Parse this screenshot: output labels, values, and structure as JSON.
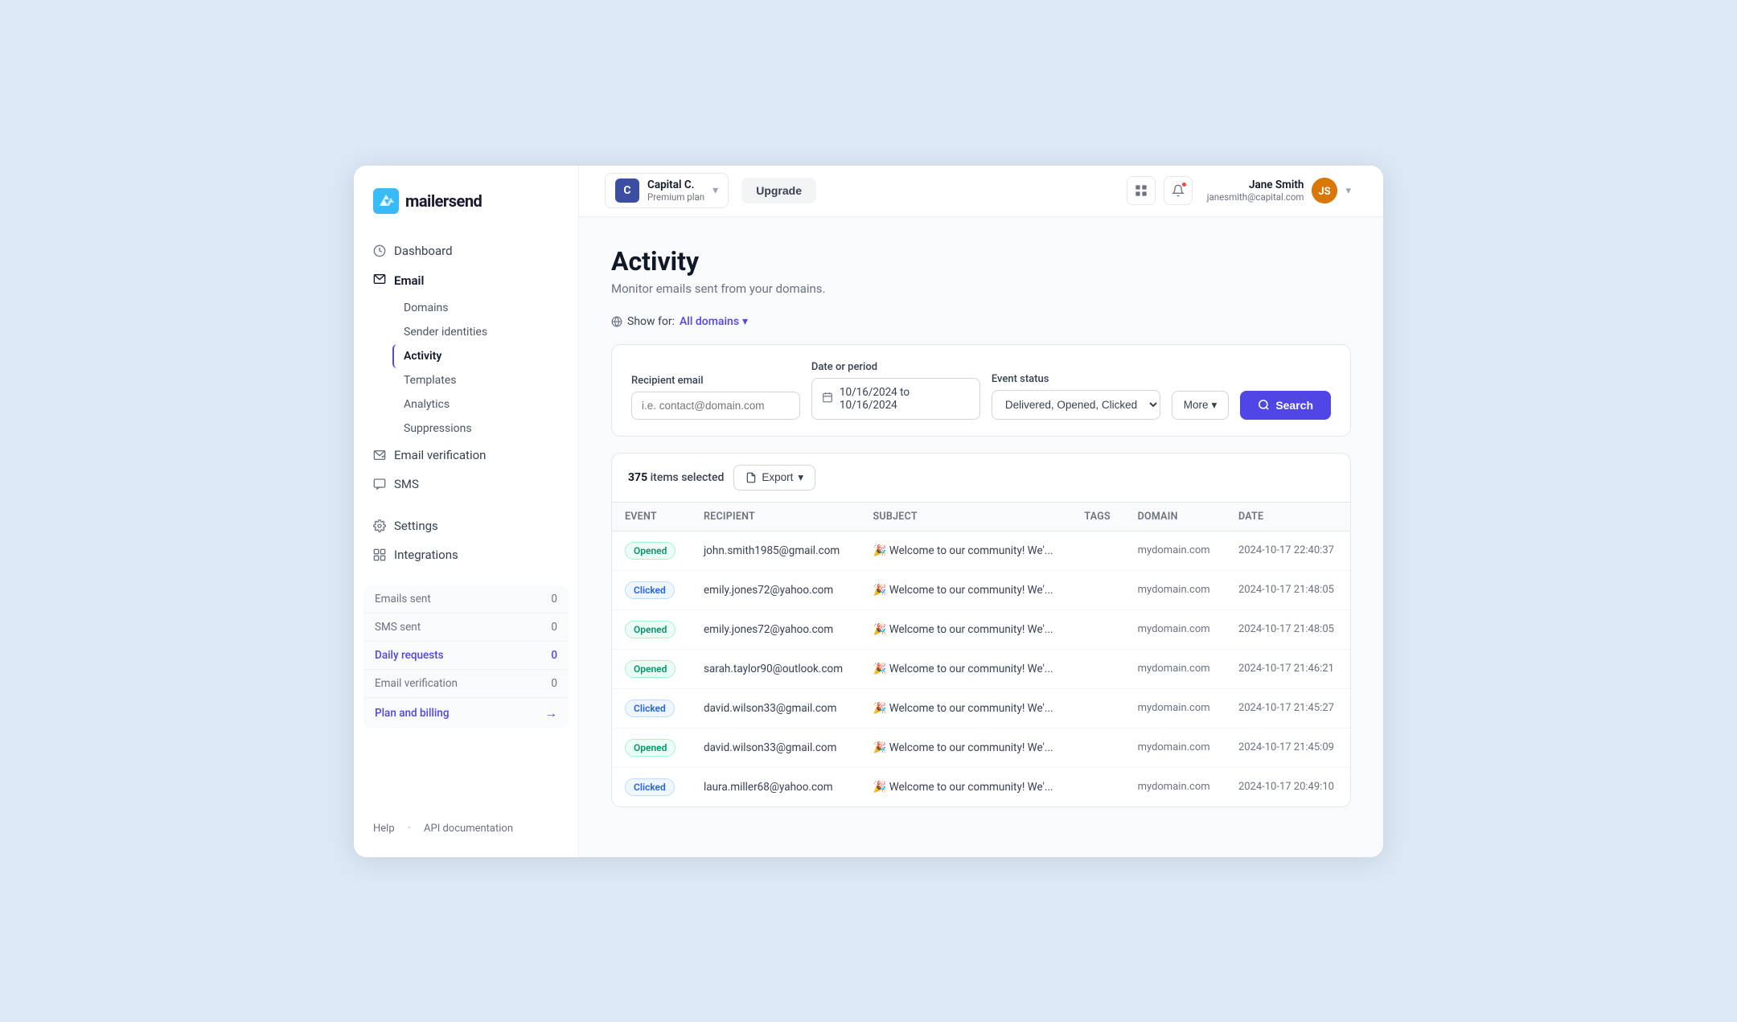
{
  "app": {
    "logo_text": "mailersend"
  },
  "sidebar": {
    "nav": [
      {
        "id": "dashboard",
        "label": "Dashboard",
        "icon": "clock"
      },
      {
        "id": "email",
        "label": "Email",
        "icon": "email",
        "children": [
          {
            "id": "domains",
            "label": "Domains"
          },
          {
            "id": "sender-identities",
            "label": "Sender identities"
          },
          {
            "id": "activity",
            "label": "Activity",
            "active": true
          },
          {
            "id": "templates",
            "label": "Templates"
          },
          {
            "id": "analytics",
            "label": "Analytics"
          },
          {
            "id": "suppressions",
            "label": "Suppressions"
          }
        ]
      },
      {
        "id": "email-verification",
        "label": "Email verification",
        "icon": "email-check"
      },
      {
        "id": "sms",
        "label": "SMS",
        "icon": "sms"
      }
    ],
    "tools": [
      {
        "id": "settings",
        "label": "Settings",
        "icon": "gear"
      },
      {
        "id": "integrations",
        "label": "Integrations",
        "icon": "integrations"
      }
    ],
    "metrics": [
      {
        "label": "Emails sent",
        "value": "0",
        "highlight": false
      },
      {
        "label": "SMS sent",
        "value": "0",
        "highlight": false
      },
      {
        "label": "Daily requests",
        "value": "0",
        "highlight": true
      },
      {
        "label": "Email verification",
        "value": "0",
        "highlight": false
      },
      {
        "label": "Plan and billing",
        "value": "→",
        "highlight": true,
        "is_link": true
      }
    ],
    "footer": {
      "help": "Help",
      "api_docs": "API documentation"
    }
  },
  "topbar": {
    "org_name": "Capital C.",
    "org_plan": "Premium plan",
    "org_initial": "C",
    "upgrade_label": "Upgrade",
    "user_name": "Jane Smith",
    "user_email": "janesmith@capital.com",
    "user_initials": "JS"
  },
  "page": {
    "title": "Activity",
    "subtitle": "Monitor emails sent from your domains.",
    "domain_filter_label": "Show for:",
    "domain_filter_value": "All domains",
    "filter": {
      "recipient_label": "Recipient email",
      "recipient_placeholder": "i.e. contact@domain.com",
      "date_label": "Date or period",
      "date_value": "10/16/2024 to 10/16/2024",
      "event_label": "Event status",
      "event_value": "Delivered, Opened, Clicked",
      "more_label": "More",
      "search_label": "Search"
    },
    "table": {
      "items_selected": "375",
      "items_label": "items selected",
      "export_label": "Export",
      "columns": [
        "Event",
        "Recipient",
        "Subject",
        "Tags",
        "Domain",
        "Date"
      ],
      "rows": [
        {
          "event": "Opened",
          "event_type": "opened",
          "recipient": "john.smith1985@gmail.com",
          "subject": "🎉 Welcome to our community! We'...",
          "tags": "",
          "domain": "mydomain.com",
          "date": "2024-10-17 22:40:37"
        },
        {
          "event": "Clicked",
          "event_type": "clicked",
          "recipient": "emily.jones72@yahoo.com",
          "subject": "🎉 Welcome to our community! We'...",
          "tags": "",
          "domain": "mydomain.com",
          "date": "2024-10-17 21:48:05"
        },
        {
          "event": "Opened",
          "event_type": "opened",
          "recipient": "emily.jones72@yahoo.com",
          "subject": "🎉 Welcome to our community! We'...",
          "tags": "",
          "domain": "mydomain.com",
          "date": "2024-10-17 21:48:05"
        },
        {
          "event": "Opened",
          "event_type": "opened",
          "recipient": "sarah.taylor90@outlook.com",
          "subject": "🎉 Welcome to our community! We'...",
          "tags": "",
          "domain": "mydomain.com",
          "date": "2024-10-17 21:46:21"
        },
        {
          "event": "Clicked",
          "event_type": "clicked",
          "recipient": "david.wilson33@gmail.com",
          "subject": "🎉 Welcome to our community! We'...",
          "tags": "",
          "domain": "mydomain.com",
          "date": "2024-10-17 21:45:27"
        },
        {
          "event": "Opened",
          "event_type": "opened",
          "recipient": "david.wilson33@gmail.com",
          "subject": "🎉 Welcome to our community! We'...",
          "tags": "",
          "domain": "mydomain.com",
          "date": "2024-10-17 21:45:09"
        },
        {
          "event": "Clicked",
          "event_type": "clicked",
          "recipient": "laura.miller68@yahoo.com",
          "subject": "🎉 Welcome to our community! We'...",
          "tags": "",
          "domain": "mydomain.com",
          "date": "2024-10-17 20:49:10"
        }
      ]
    }
  }
}
